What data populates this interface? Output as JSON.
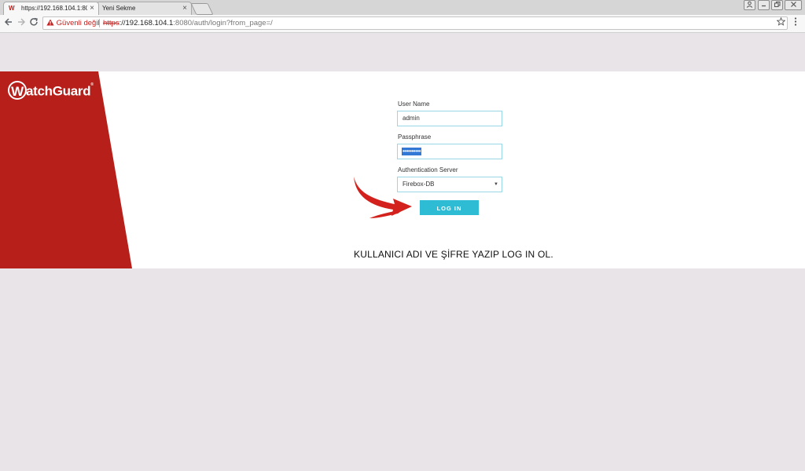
{
  "browser": {
    "tabs": [
      {
        "title": "https://192.168.104.1:808",
        "favicon": "W"
      },
      {
        "title": "Yeni Sekme",
        "favicon": ""
      }
    ],
    "close_glyph": "×",
    "security_label": "Güvenli değil",
    "url_scheme": "https",
    "url_host": "://192.168.104.1",
    "url_path": ":8080/auth/login?from_page=/"
  },
  "brand": {
    "logo_letter": "W",
    "logo_rest": "atchGuard",
    "reg": "®",
    "accent_red": "#b71f1a",
    "button_blue": "#2ebcd5"
  },
  "form": {
    "username_label": "User Name",
    "username_value": "admin",
    "passphrase_label": "Passphrase",
    "passphrase_value": "••••••••••",
    "auth_server_label": "Authentication Server",
    "auth_server_value": "Firebox-DB",
    "login_label": "LOG IN"
  },
  "annotation": {
    "caption": "KULLANICI ADI VE ŞİFRE YAZIP LOG IN OL."
  }
}
